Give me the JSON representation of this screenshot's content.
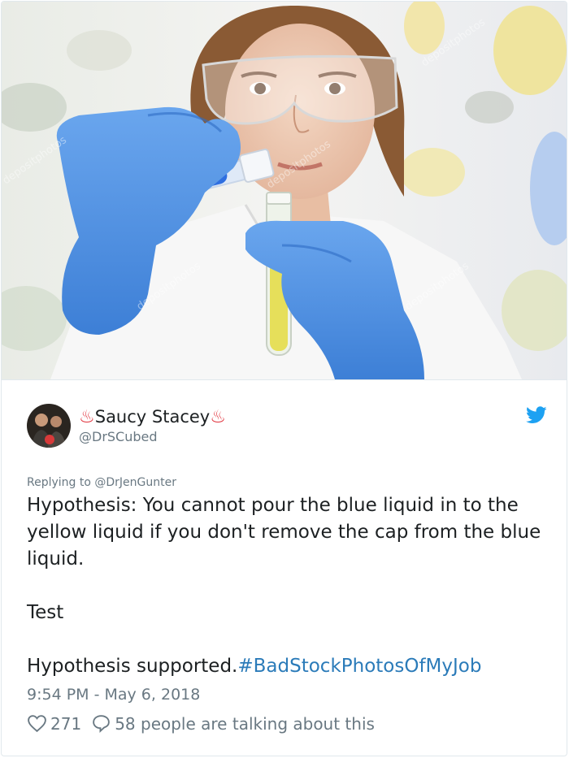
{
  "tweet": {
    "display_name": "Saucy Stacey",
    "name_emoji_left": "♨",
    "name_emoji_right": "♨",
    "handle": "@DrSCubed",
    "reply_prefix": "Replying to ",
    "reply_handle": "@DrJenGunter",
    "body_text": "Hypothesis: You cannot pour the blue liquid in to the yellow liquid if you don't remove the cap from the blue liquid.\n\nTest\n\nHypothesis supported.",
    "hashtag": "#BadStockPhotosOfMyJob",
    "timestamp": "9:54 PM - May 6, 2018",
    "like_count": "271",
    "reply_text": "58 people are talking about this"
  },
  "image": {
    "watermark": "depositphotos"
  },
  "colors": {
    "link": "#2b7bb9",
    "meta": "#697882",
    "twitter_blue": "#1da1f2",
    "glove": "#4a8fe0",
    "emoji": "#e0303a"
  },
  "icons": {
    "brand": "twitter-bird-icon",
    "like": "heart-icon",
    "reply": "speech-bubble-icon"
  }
}
